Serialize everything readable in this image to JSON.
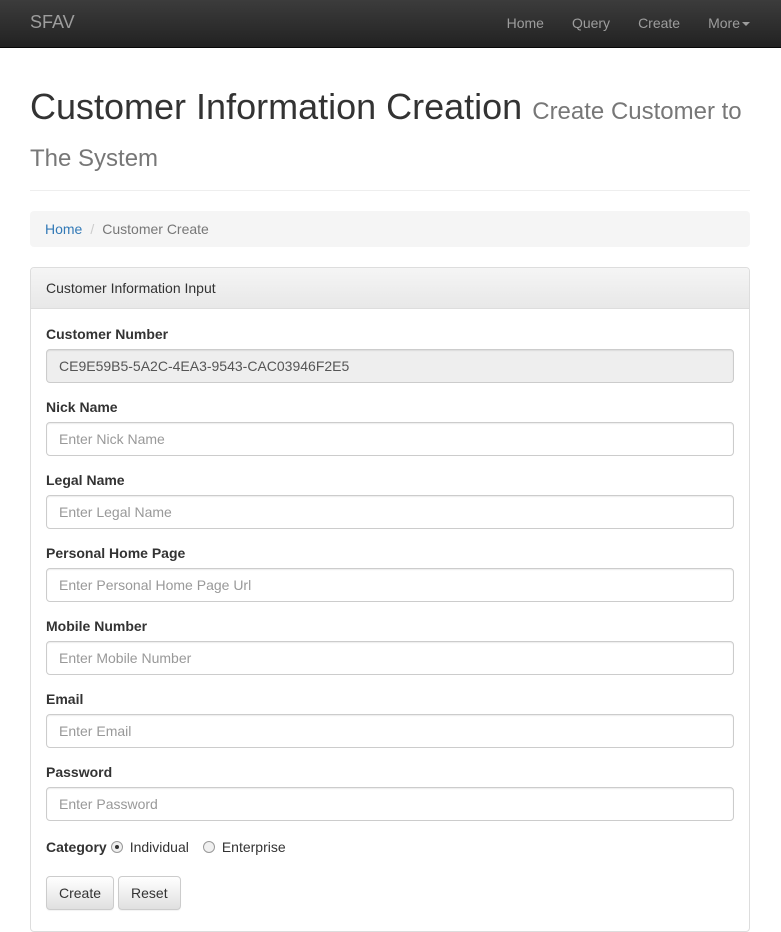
{
  "navbar": {
    "brand": "SFAV",
    "items": [
      {
        "label": "Home"
      },
      {
        "label": "Query"
      },
      {
        "label": "Create"
      },
      {
        "label": "More"
      }
    ]
  },
  "header": {
    "title": "Customer Information Creation",
    "subtitle": "Create Customer to The System"
  },
  "breadcrumb": {
    "home": "Home",
    "current": "Customer Create"
  },
  "panel": {
    "title": "Customer Information Input"
  },
  "form": {
    "customer_number": {
      "label": "Customer Number",
      "value": "CE9E59B5-5A2C-4EA3-9543-CAC03946F2E5"
    },
    "nick_name": {
      "label": "Nick Name",
      "placeholder": "Enter Nick Name"
    },
    "legal_name": {
      "label": "Legal Name",
      "placeholder": "Enter Legal Name"
    },
    "home_page": {
      "label": "Personal Home Page",
      "placeholder": "Enter Personal Home Page Url"
    },
    "mobile": {
      "label": "Mobile Number",
      "placeholder": "Enter Mobile Number"
    },
    "email": {
      "label": "Email",
      "placeholder": "Enter Email"
    },
    "password": {
      "label": "Password",
      "placeholder": "Enter Password"
    },
    "category": {
      "label": "Category",
      "options": [
        {
          "label": "Individual",
          "checked": true
        },
        {
          "label": "Enterprise",
          "checked": false
        }
      ]
    },
    "create_label": "Create",
    "reset_label": "Reset"
  },
  "colors": {
    "navbar_bg": "#222222",
    "link": "#337ab7",
    "muted": "#777777"
  },
  "icons": {
    "more_caret": "caret-down-icon"
  }
}
